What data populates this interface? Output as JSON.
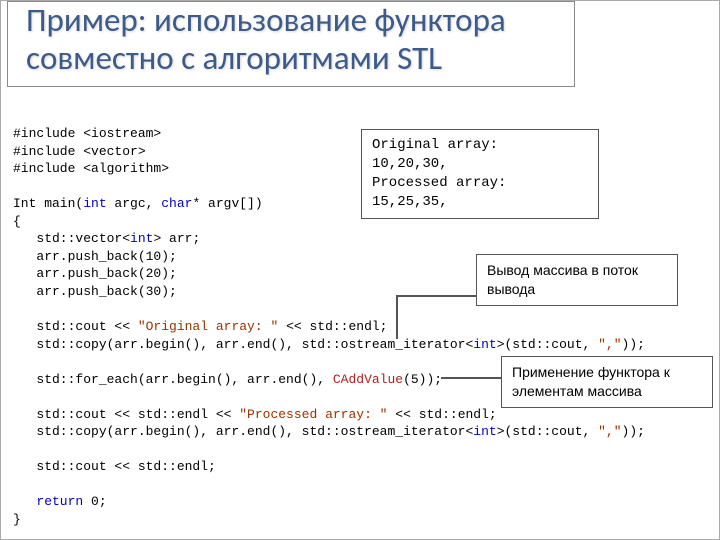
{
  "title": "Пример: использование функтора совместно с алгоритмами STL",
  "code": {
    "inc1": "#include <iostream>",
    "inc2": "#include <vector>",
    "inc3": "#include <algorithm>",
    "blank": "",
    "main_sig_a": "Int main(",
    "main_sig_b": "int",
    "main_sig_c": " argc, ",
    "main_sig_d": "char",
    "main_sig_e": "* argv[])",
    "brace_open": "{",
    "l_vec_a": "   std::vector<",
    "l_vec_b": "int",
    "l_vec_c": "> arr;",
    "l_pb10": "   arr.push_back(10);",
    "l_pb20": "   arr.push_back(20);",
    "l_pb30": "   arr.push_back(30);",
    "l_cout1a": "   std::cout << ",
    "l_cout1b": "\"Original array: \"",
    "l_cout1c": " << std::endl;",
    "l_copy1a": "   std::copy(arr.begin(), arr.end(), std::ostream_iterator<",
    "l_copy1b": "int",
    "l_copy1c": ">(std::cout, ",
    "l_copy1d": "\",\"",
    "l_copy1e": "));",
    "l_foreach_a": "   std::for_each(arr.begin(), arr.end(), ",
    "l_foreach_b": "CAddValue",
    "l_foreach_c": "(5));",
    "l_cout2a": "   std::cout << std::endl << ",
    "l_cout2b": "\"Processed array: \"",
    "l_cout2c": " << std::endl;",
    "l_copy2a": "   std::copy(arr.begin(), arr.end(), std::ostream_iterator<",
    "l_copy2b": "int",
    "l_copy2c": ">(std::cout, ",
    "l_copy2d": "\",\"",
    "l_copy2e": "));",
    "l_cout3": "   std::cout << std::endl;",
    "l_ret_a": "   ",
    "l_ret_b": "return",
    "l_ret_c": " 0;",
    "brace_close": "}"
  },
  "output_box": {
    "l1": "Original array:",
    "l2": "10,20,30,",
    "l3": "Processed array:",
    "l4": "15,25,35,"
  },
  "callouts": {
    "stream": "Вывод массива в поток вывода",
    "functor": "Применение функтора к элементам массива"
  }
}
